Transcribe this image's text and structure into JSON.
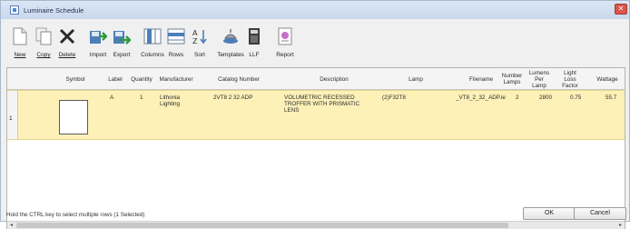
{
  "window": {
    "title": "Luminaire Schedule",
    "close_glyph": "✕"
  },
  "toolbar": {
    "buttons": [
      {
        "label": "New",
        "icon": "new-document-icon"
      },
      {
        "label": "Copy",
        "icon": "copy-icon"
      },
      {
        "label": "Delete",
        "icon": "delete-x-icon"
      },
      {
        "label": "Import",
        "icon": "import-icon"
      },
      {
        "label": "Export",
        "icon": "export-icon"
      },
      {
        "label": "Columns",
        "icon": "columns-icon"
      },
      {
        "label": "Rows",
        "icon": "rows-icon"
      },
      {
        "label": "Sort",
        "icon": "sort-az-icon"
      },
      {
        "label": "Templates",
        "icon": "templates-icon"
      },
      {
        "label": "LLF",
        "icon": "llf-icon"
      },
      {
        "label": "Report",
        "icon": "report-icon"
      }
    ]
  },
  "grid": {
    "headers": {
      "symbol": "Symbol",
      "label": "Label",
      "quantity": "Quantity",
      "manufacturer": "Manufacturer",
      "catalog": "Catalog Number",
      "description": "Description",
      "lamp": "Lamp",
      "filename": "Filename",
      "num_lamps": "Number Lamps",
      "lumens": "Lumens Per Lamp",
      "llf": "Light Loss Factor",
      "wattage": "Wattage"
    },
    "rows": [
      {
        "number": "1",
        "label": "A",
        "quantity": "1",
        "manufacturer": "Lithonia Lighting",
        "catalog": "2VT8 2 32 ADP",
        "description": "VOLUMETRIC RECESSED TROFFER WITH PRISMATIC LENS",
        "lamp": "(2)F32T8",
        "filename": "_VT8_2_32_ADP.ie",
        "num_lamps": "2",
        "lumens": "2800",
        "llf": "0.75",
        "wattage": "55.7"
      }
    ]
  },
  "status": {
    "text": "Hold the CTRL key to select multiple rows (1 Selected)",
    "ok_label": "OK",
    "cancel_label": "Cancel"
  },
  "scroll": {
    "left_arrow": "◂",
    "right_arrow": "▸"
  }
}
